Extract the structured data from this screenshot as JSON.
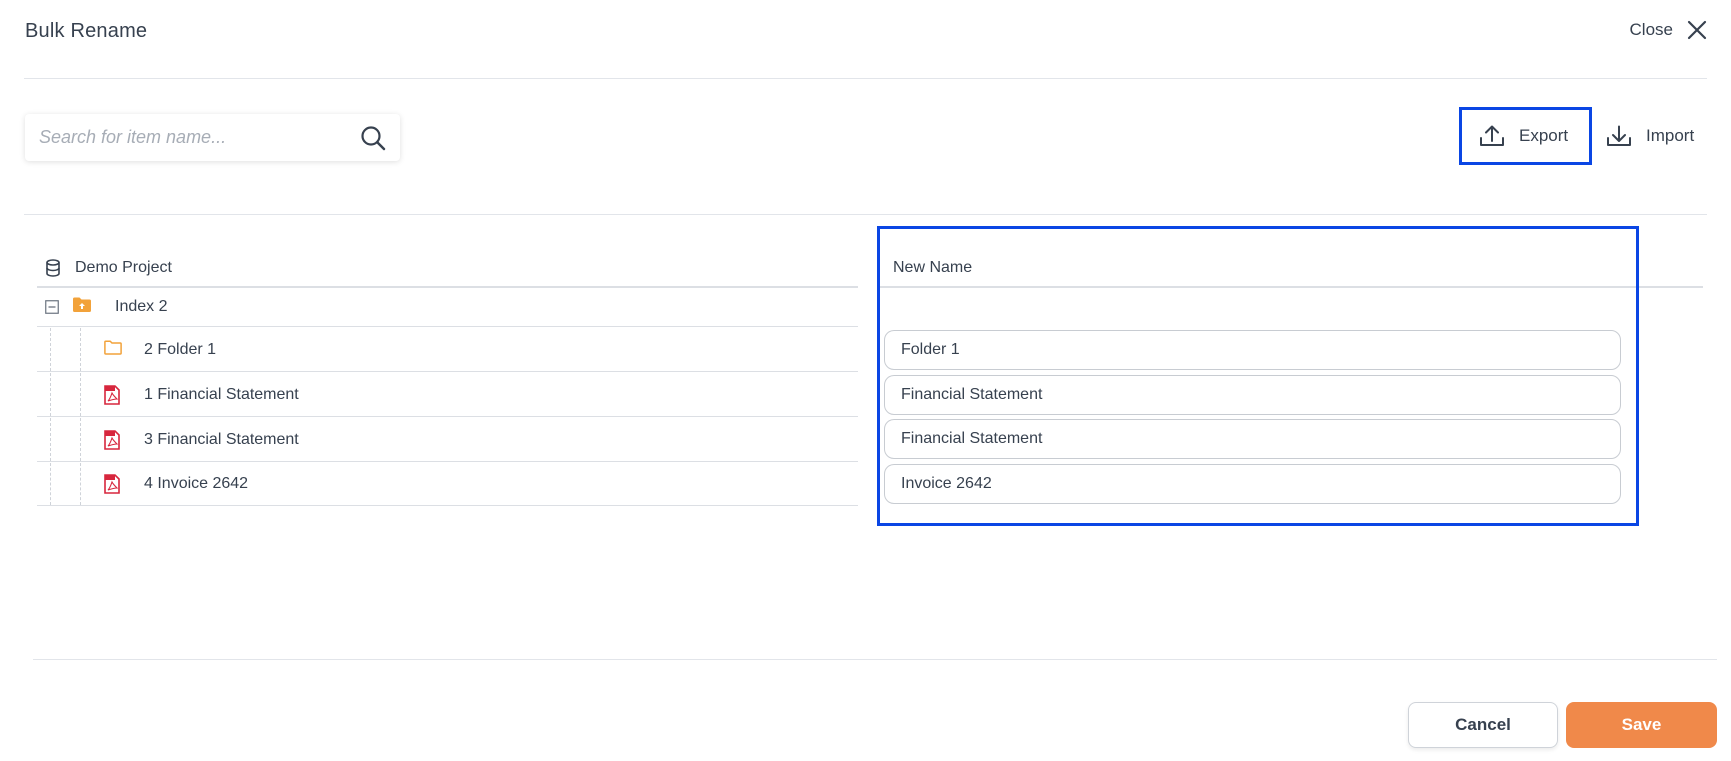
{
  "dialog": {
    "title": "Bulk Rename",
    "close_label": "Close"
  },
  "search": {
    "placeholder": "Search for item name...",
    "value": ""
  },
  "toolbar": {
    "export_label": "Export",
    "import_label": "Import"
  },
  "tree": {
    "root_label": "Demo Project",
    "rows": [
      {
        "label": "Index 2",
        "icon": "index-folder-icon",
        "level": 0
      },
      {
        "label": "2 Folder 1",
        "icon": "folder-icon",
        "level": 1
      },
      {
        "label": "1 Financial Statement",
        "icon": "pdf-file-icon",
        "level": 1
      },
      {
        "label": "3 Financial Statement",
        "icon": "pdf-file-icon",
        "level": 1
      },
      {
        "label": "4 Invoice 2642",
        "icon": "pdf-file-icon",
        "level": 1
      }
    ]
  },
  "new_name": {
    "header": "New Name",
    "values": [
      "Folder 1",
      "Financial Statement",
      "Financial Statement",
      "Invoice 2642"
    ]
  },
  "footer": {
    "cancel_label": "Cancel",
    "save_label": "Save"
  },
  "colors": {
    "accent": "#f0894a",
    "highlight": "#0a46e4",
    "folder": "#f2a23a",
    "pdf": "#d7263d"
  }
}
